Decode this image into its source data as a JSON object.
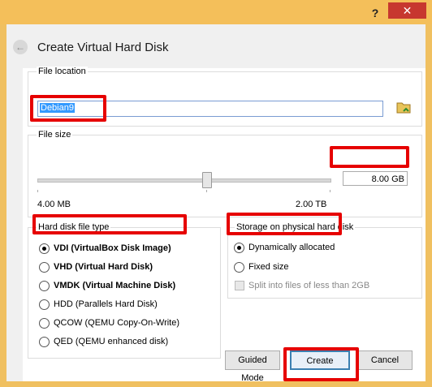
{
  "window": {
    "help_label": "?",
    "close_label": "✕"
  },
  "header": {
    "title": "Create Virtual Hard Disk",
    "back_icon": "back-arrow-icon"
  },
  "file_location": {
    "label": "File location",
    "value": "Debian9"
  },
  "file_size": {
    "label": "File size",
    "value": "8.00 GB",
    "min_label": "4.00 MB",
    "max_label": "2.00 TB"
  },
  "disk_type": {
    "label": "Hard disk file type",
    "options": [
      {
        "label": "VDI (VirtualBox Disk Image)",
        "selected": true
      },
      {
        "label": "VHD (Virtual Hard Disk)",
        "selected": false
      },
      {
        "label": "VMDK (Virtual Machine Disk)",
        "selected": false
      },
      {
        "label": "HDD (Parallels Hard Disk)",
        "selected": false
      },
      {
        "label": "QCOW (QEMU Copy-On-Write)",
        "selected": false
      },
      {
        "label": "QED (QEMU enhanced disk)",
        "selected": false
      }
    ]
  },
  "storage": {
    "label": "Storage on physical hard disk",
    "options": [
      {
        "label": "Dynamically allocated",
        "selected": true
      },
      {
        "label": "Fixed size",
        "selected": false
      }
    ],
    "split_label": "Split into files of less than 2GB"
  },
  "buttons": {
    "guided": "Guided Mode",
    "create": "Create",
    "cancel": "Cancel"
  }
}
